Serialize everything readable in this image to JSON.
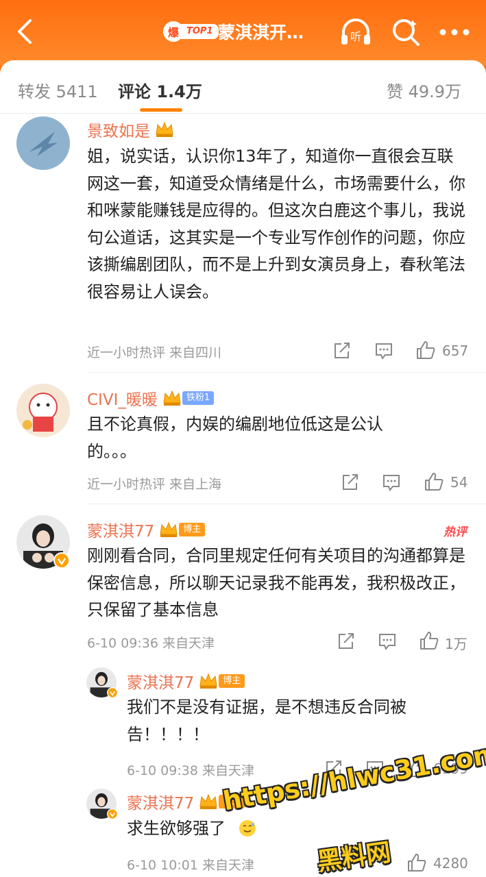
{
  "header": {
    "hot_badge": "爆",
    "hot_rank": "TOP1",
    "title": "蒙淇淇开…"
  },
  "tabs": {
    "repost": "转发 5411",
    "comments": "评论 1.4万",
    "likes": "赞 49.9万"
  },
  "comments": [
    {
      "user": "景致如是",
      "text": "姐，说实话，认识你13年了，知道你一直很会互联网这一套，知道受众情绪是什么，市场需要什么，你和咪蒙能赚钱是应得的。但这次白鹿这个事儿，我说句公道话，这其实是一个专业写作创作的问题，你应该撕编剧团队，而不是上升到女演员身上，春秋笔法很容易让人误会。",
      "meta": "近一小时热评  来自四川",
      "likes": "657"
    },
    {
      "user": "CIVI_暖暖",
      "tag": "铁粉1",
      "text": "且不论真假，内娱的编剧地位低这是公认的。。。",
      "meta": "近一小时热评  来自上海",
      "likes": "54"
    },
    {
      "user": "蒙淇淇77",
      "tag": "博主",
      "hot_label": "热评",
      "text": "刚刚看合同，合同里规定任何有关项目的沟通都算是保密信息，所以聊天记录我不能再发，我积极改正，只保留了基本信息",
      "meta": "6-10 09:36  来自天津",
      "likes": "1万"
    }
  ],
  "replies": [
    {
      "user": "蒙淇淇77",
      "tag": "博主",
      "text": "我们不是没有证据，是不想违反合同被告！！！！",
      "meta": "6-10 09:38  来自天津",
      "likes": "6199"
    },
    {
      "user": "蒙淇淇77",
      "tag": "博主",
      "text": "求生欲够强了",
      "meta": "6-10 10:01  来自天津",
      "likes": "4280"
    }
  ],
  "watermark": {
    "line1": "https://hlwc31.com",
    "line2": "黑料网"
  },
  "colors": {
    "accent": "#ff8200",
    "username": "#eb7350",
    "header": "#ff7a1a"
  }
}
